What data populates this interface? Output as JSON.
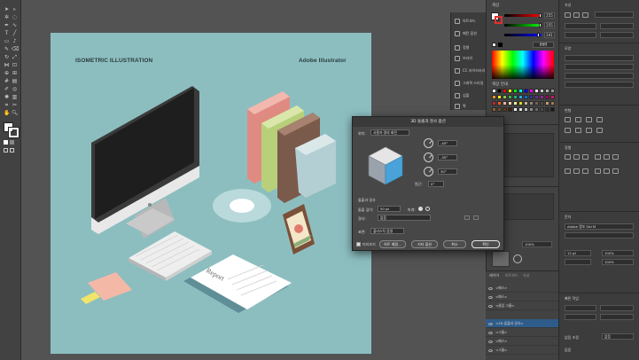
{
  "artboard": {
    "title_left": "ISOMETRIC ILLUSTRATION",
    "title_right": "Adobe Illustrator",
    "report_text": "Report"
  },
  "icon_strip": [
    {
      "label": "아트보드",
      "icon": "artboard-icon"
    },
    {
      "label": "패턴 옵션",
      "icon": "pattern-icon"
    },
    {
      "label": "정렬",
      "icon": "align-icon"
    },
    {
      "label": "브러쉬",
      "icon": "brush-icon"
    },
    {
      "label": "CC 라이브러리",
      "icon": "library-icon"
    },
    {
      "label": "그래픽 스타일",
      "icon": "graphic-style-icon"
    },
    {
      "label": "심볼",
      "icon": "symbol-icon"
    },
    {
      "label": "획",
      "icon": "stroke-icon"
    }
  ],
  "color_panel": {
    "tab": "색상",
    "tab2": "색상 안내",
    "values": [
      "255",
      "255",
      "241"
    ],
    "hex": "ffffff"
  },
  "dialog": {
    "title": "3D 돌출과 경사 옵션",
    "position_label": "위치:",
    "position_value": "사용자 정의 회전",
    "angles": [
      "-45°",
      "-35°",
      "30°"
    ],
    "perspective_label": "원근:",
    "perspective_value": "0°",
    "extrude_section": "돌출과 경사",
    "depth_label": "돌출 깊이:",
    "depth_value": "50 pt",
    "cap_label": "마개:",
    "bevel_label": "경사:",
    "bevel_value": "없음",
    "surface_label": "표면:",
    "surface_value": "플라스틱 음영",
    "preview_label": "미리보기",
    "map_button": "아트 매핑...",
    "more_button": "기타 옵션",
    "cancel_button": "취소",
    "ok_button": "확인"
  },
  "properties": {
    "header": "속성",
    "transform": "변형",
    "appearance": "모양",
    "quick_actions": "빠른 작업",
    "align": "정렬",
    "pathfinder": "패스파인더",
    "character": "문자",
    "font": "Adobe 명조 Std M",
    "size": "12 pt",
    "leading": "100%",
    "zoom": "100%",
    "fill_label": "획",
    "opacity_label": "불투명도",
    "opacity_value": "100%",
    "style_label": "효과",
    "bottom_left": "없음 조정",
    "bottom_right": "없음",
    "bottom_value": "없음"
  },
  "layers": {
    "tabs": [
      "레이어",
      "아트보드",
      "속성"
    ],
    "rows": [
      {
        "name": "<패스>"
      },
      {
        "name": "<패스>"
      },
      {
        "name": "<클립 그룹>"
      },
      {
        "name": "<3D 돌출과 경사>",
        "selected": true
      },
      {
        "name": "<그룹>"
      },
      {
        "name": "<패스>"
      },
      {
        "name": "<그룹>"
      }
    ]
  },
  "colors": {
    "artboard_bg": "#8cbec0",
    "accent_blue": "#2e5c8a"
  }
}
